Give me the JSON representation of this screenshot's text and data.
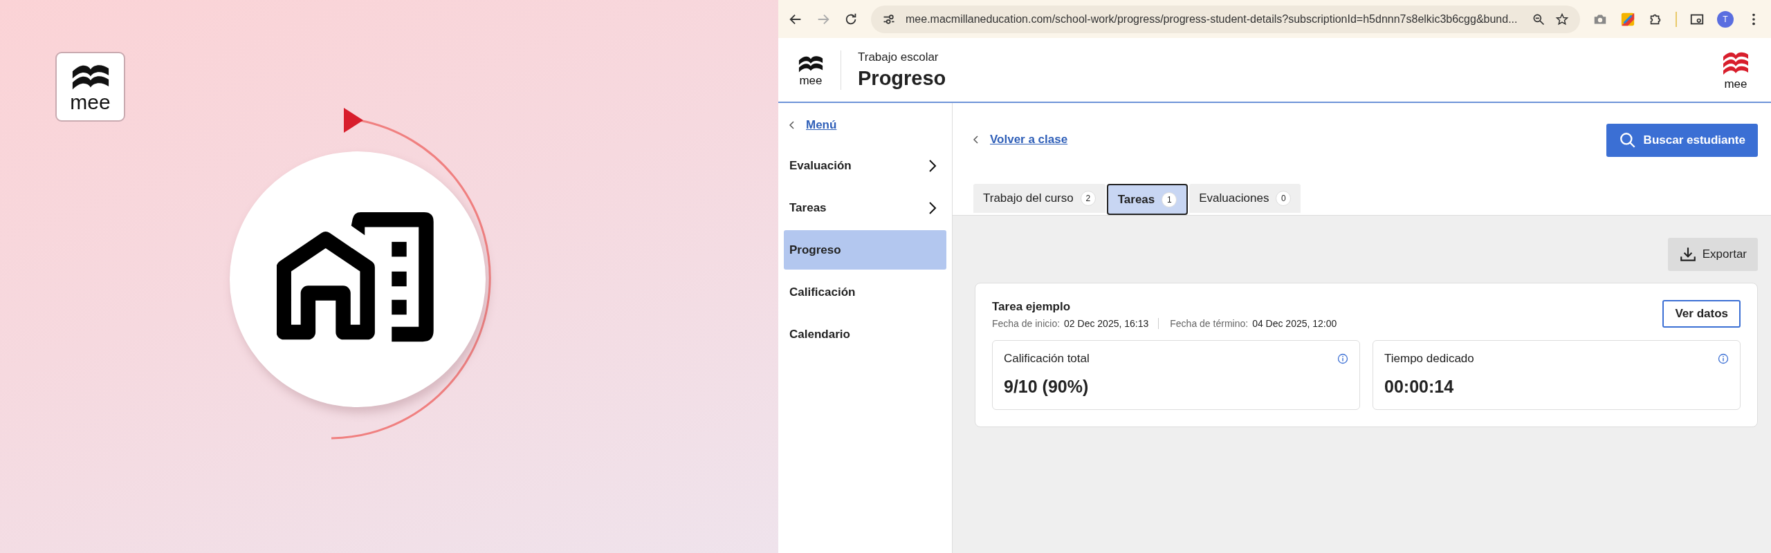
{
  "promo": {
    "logo_text": "mee"
  },
  "browser": {
    "url": "mee.macmillaneducation.com/school-work/progress/progress-student-details?subscriptionId=h5dnnn7s8elkic3b6cgg&bund...",
    "avatar": "T"
  },
  "header": {
    "logo_text": "mee",
    "subtitle": "Trabajo escolar",
    "title": "Progreso",
    "brand_logo_text": "mee"
  },
  "sidebar": {
    "back": "Menú",
    "items": [
      {
        "label": "Evaluación",
        "kind": "group",
        "selected": false
      },
      {
        "label": "Tareas",
        "kind": "group",
        "selected": false
      },
      {
        "label": "Progreso",
        "kind": "link",
        "selected": true
      },
      {
        "label": "Calificación",
        "kind": "link",
        "selected": false
      },
      {
        "label": "Calendario",
        "kind": "link",
        "selected": false
      }
    ]
  },
  "main": {
    "back_link": "Volver a clase",
    "search_button": "Buscar estudiante",
    "tabs": [
      {
        "label": "Trabajo del curso",
        "count": "2",
        "selected": false
      },
      {
        "label": "Tareas",
        "count": "1",
        "selected": true
      },
      {
        "label": "Evaluaciones",
        "count": "0",
        "selected": false
      }
    ],
    "export_button": "Exportar",
    "task": {
      "title": "Tarea ejemplo",
      "start_label": "Fecha de inicio:",
      "start_value": "02 Dec 2025, 16:13",
      "end_label": "Fecha de término:",
      "end_value": "04 Dec 2025, 12:00",
      "button": "Ver datos",
      "stats": [
        {
          "label": "Calificación total",
          "value": "9/10 (90%)"
        },
        {
          "label": "Tiempo dedicado",
          "value": "00:00:14"
        }
      ]
    }
  }
}
